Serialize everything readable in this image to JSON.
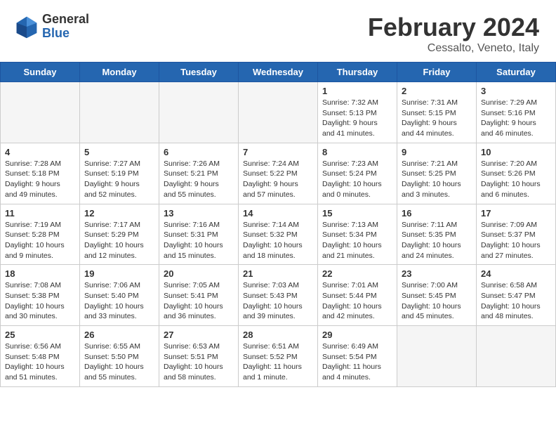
{
  "header": {
    "logo_general": "General",
    "logo_blue": "Blue",
    "title": "February 2024",
    "subtitle": "Cessalto, Veneto, Italy"
  },
  "days_of_week": [
    "Sunday",
    "Monday",
    "Tuesday",
    "Wednesday",
    "Thursday",
    "Friday",
    "Saturday"
  ],
  "weeks": [
    [
      {
        "day": "",
        "info": ""
      },
      {
        "day": "",
        "info": ""
      },
      {
        "day": "",
        "info": ""
      },
      {
        "day": "",
        "info": ""
      },
      {
        "day": "1",
        "info": "Sunrise: 7:32 AM\nSunset: 5:13 PM\nDaylight: 9 hours\nand 41 minutes."
      },
      {
        "day": "2",
        "info": "Sunrise: 7:31 AM\nSunset: 5:15 PM\nDaylight: 9 hours\nand 44 minutes."
      },
      {
        "day": "3",
        "info": "Sunrise: 7:29 AM\nSunset: 5:16 PM\nDaylight: 9 hours\nand 46 minutes."
      }
    ],
    [
      {
        "day": "4",
        "info": "Sunrise: 7:28 AM\nSunset: 5:18 PM\nDaylight: 9 hours\nand 49 minutes."
      },
      {
        "day": "5",
        "info": "Sunrise: 7:27 AM\nSunset: 5:19 PM\nDaylight: 9 hours\nand 52 minutes."
      },
      {
        "day": "6",
        "info": "Sunrise: 7:26 AM\nSunset: 5:21 PM\nDaylight: 9 hours\nand 55 minutes."
      },
      {
        "day": "7",
        "info": "Sunrise: 7:24 AM\nSunset: 5:22 PM\nDaylight: 9 hours\nand 57 minutes."
      },
      {
        "day": "8",
        "info": "Sunrise: 7:23 AM\nSunset: 5:24 PM\nDaylight: 10 hours\nand 0 minutes."
      },
      {
        "day": "9",
        "info": "Sunrise: 7:21 AM\nSunset: 5:25 PM\nDaylight: 10 hours\nand 3 minutes."
      },
      {
        "day": "10",
        "info": "Sunrise: 7:20 AM\nSunset: 5:26 PM\nDaylight: 10 hours\nand 6 minutes."
      }
    ],
    [
      {
        "day": "11",
        "info": "Sunrise: 7:19 AM\nSunset: 5:28 PM\nDaylight: 10 hours\nand 9 minutes."
      },
      {
        "day": "12",
        "info": "Sunrise: 7:17 AM\nSunset: 5:29 PM\nDaylight: 10 hours\nand 12 minutes."
      },
      {
        "day": "13",
        "info": "Sunrise: 7:16 AM\nSunset: 5:31 PM\nDaylight: 10 hours\nand 15 minutes."
      },
      {
        "day": "14",
        "info": "Sunrise: 7:14 AM\nSunset: 5:32 PM\nDaylight: 10 hours\nand 18 minutes."
      },
      {
        "day": "15",
        "info": "Sunrise: 7:13 AM\nSunset: 5:34 PM\nDaylight: 10 hours\nand 21 minutes."
      },
      {
        "day": "16",
        "info": "Sunrise: 7:11 AM\nSunset: 5:35 PM\nDaylight: 10 hours\nand 24 minutes."
      },
      {
        "day": "17",
        "info": "Sunrise: 7:09 AM\nSunset: 5:37 PM\nDaylight: 10 hours\nand 27 minutes."
      }
    ],
    [
      {
        "day": "18",
        "info": "Sunrise: 7:08 AM\nSunset: 5:38 PM\nDaylight: 10 hours\nand 30 minutes."
      },
      {
        "day": "19",
        "info": "Sunrise: 7:06 AM\nSunset: 5:40 PM\nDaylight: 10 hours\nand 33 minutes."
      },
      {
        "day": "20",
        "info": "Sunrise: 7:05 AM\nSunset: 5:41 PM\nDaylight: 10 hours\nand 36 minutes."
      },
      {
        "day": "21",
        "info": "Sunrise: 7:03 AM\nSunset: 5:43 PM\nDaylight: 10 hours\nand 39 minutes."
      },
      {
        "day": "22",
        "info": "Sunrise: 7:01 AM\nSunset: 5:44 PM\nDaylight: 10 hours\nand 42 minutes."
      },
      {
        "day": "23",
        "info": "Sunrise: 7:00 AM\nSunset: 5:45 PM\nDaylight: 10 hours\nand 45 minutes."
      },
      {
        "day": "24",
        "info": "Sunrise: 6:58 AM\nSunset: 5:47 PM\nDaylight: 10 hours\nand 48 minutes."
      }
    ],
    [
      {
        "day": "25",
        "info": "Sunrise: 6:56 AM\nSunset: 5:48 PM\nDaylight: 10 hours\nand 51 minutes."
      },
      {
        "day": "26",
        "info": "Sunrise: 6:55 AM\nSunset: 5:50 PM\nDaylight: 10 hours\nand 55 minutes."
      },
      {
        "day": "27",
        "info": "Sunrise: 6:53 AM\nSunset: 5:51 PM\nDaylight: 10 hours\nand 58 minutes."
      },
      {
        "day": "28",
        "info": "Sunrise: 6:51 AM\nSunset: 5:52 PM\nDaylight: 11 hours\nand 1 minute."
      },
      {
        "day": "29",
        "info": "Sunrise: 6:49 AM\nSunset: 5:54 PM\nDaylight: 11 hours\nand 4 minutes."
      },
      {
        "day": "",
        "info": ""
      },
      {
        "day": "",
        "info": ""
      }
    ]
  ]
}
